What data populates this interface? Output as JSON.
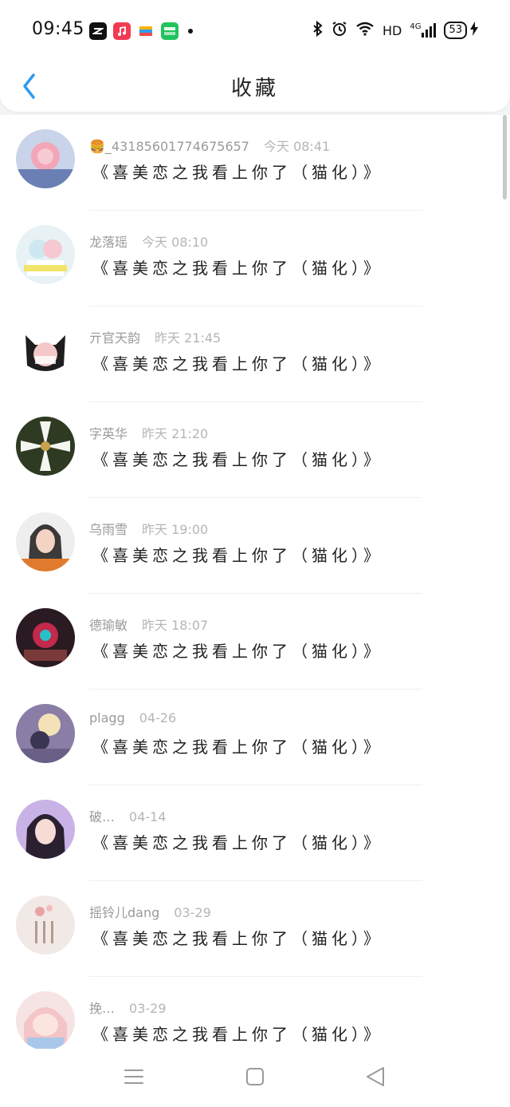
{
  "status": {
    "time": "09:45",
    "network": "HD",
    "network_gen": "4G",
    "battery": "53",
    "icons": [
      "capcut-icon",
      "music-icon",
      "wallet-icon",
      "iqiyi-icon",
      "bluetooth-icon",
      "alarm-icon",
      "wifi-icon",
      "signal-icon",
      "charging-icon"
    ]
  },
  "header": {
    "title": "收藏",
    "back_icon": "chevron-left-icon"
  },
  "colors": {
    "accent": "#2d9bf0",
    "text": "#222222",
    "meta": "#9a9a9a"
  },
  "items": [
    {
      "user": "🍔_43185601774675657",
      "time": "今天 08:41",
      "title": "《喜美恋之我看上你了（猫化）》"
    },
    {
      "user": "龙落瑶",
      "time": "今天 08:10",
      "title": "《喜美恋之我看上你了（猫化）》"
    },
    {
      "user": "亓官天韵",
      "time": "昨天 21:45",
      "title": "《喜美恋之我看上你了（猫化）》"
    },
    {
      "user": "字英华",
      "time": "昨天 21:20",
      "title": "《喜美恋之我看上你了（猫化）》"
    },
    {
      "user": "乌雨雪",
      "time": "昨天 19:00",
      "title": "《喜美恋之我看上你了（猫化）》"
    },
    {
      "user": "德瑜敏",
      "time": "昨天 18:07",
      "title": "《喜美恋之我看上你了（猫化）》"
    },
    {
      "user": "plagg",
      "time": "04-26",
      "title": "《喜美恋之我看上你了（猫化）》"
    },
    {
      "user": "破…",
      "time": "04-14",
      "title": "《喜美恋之我看上你了（猫化）》"
    },
    {
      "user": "摇铃儿dang",
      "time": "03-29",
      "title": "《喜美恋之我看上你了（猫化）》"
    },
    {
      "user": "挽…",
      "time": "03-29",
      "title": "《喜美恋之我看上你了（猫化）》"
    }
  ],
  "nav": {
    "icons": [
      "menu-icon",
      "home-square-icon",
      "back-triangle-icon"
    ]
  }
}
